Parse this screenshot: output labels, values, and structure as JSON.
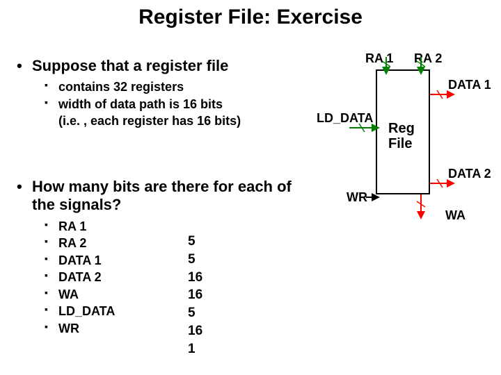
{
  "title": "Register File: Exercise",
  "bullet1": "Suppose that a register file",
  "sub1a": "contains 32 registers",
  "sub1b": "width of data path is 16 bits",
  "sub1c": "(i.e. , each register has 16 bits)",
  "bullet2": "How many bits are there for each of the signals?",
  "signals": {
    "s0": "RA 1",
    "s1": "RA 2",
    "s2": "DATA 1",
    "s3": "DATA 2",
    "s4": "WA",
    "s5": "LD_DATA",
    "s6": "WR"
  },
  "answers": {
    "a0": "5",
    "a1": "5",
    "a2": "16",
    "a3": "16",
    "a4": "5",
    "a5": "16",
    "a6": "1"
  },
  "diagram": {
    "ra1": "RA 1",
    "ra2": "RA 2",
    "data1": "DATA 1",
    "data2": "DATA 2",
    "ld_data": "LD_DATA",
    "reg": "Reg",
    "file": "File",
    "wr": "WR",
    "wa": "WA"
  },
  "colors": {
    "arrow_in": "#008000",
    "arrow_out": "#ff0000"
  }
}
